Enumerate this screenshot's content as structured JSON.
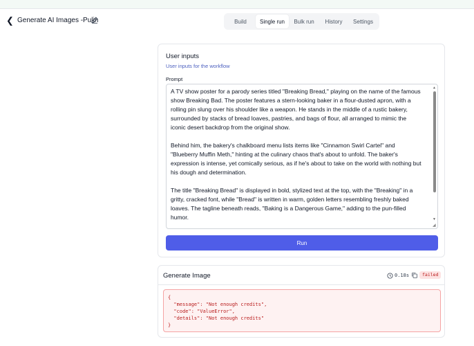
{
  "header": {
    "title": "Generate AI Images -Pulin",
    "back_icon": "chevron-left-icon",
    "edit_icon": "pencil-icon"
  },
  "tabs": [
    {
      "label": "Build",
      "active": false
    },
    {
      "label": "Single run",
      "active": true
    },
    {
      "label": "Bulk run",
      "active": false
    },
    {
      "label": "History",
      "active": false
    },
    {
      "label": "Settings",
      "active": false
    }
  ],
  "inputs_card": {
    "title": "User inputs",
    "subtitle": "User inputs for the workflow",
    "prompt_label": "Prompt",
    "prompt_value": "A TV show poster for a parody series titled \"Breaking Bread,\" playing on the name of the famous\nshow Breaking Bad. The poster features a stern-looking baker in a flour-dusted apron, with a\nrolling pin slung over his shoulder like a weapon. He stands in the middle of a rustic bakery,\nsurrounded by stacks of bread loaves, pastries, and bags of flour, all arranged to mimic the\niconic desert backdrop from the original show.\n\nBehind him, the bakery's chalkboard menu lists items like \"Cinnamon Swirl Cartel\" and\n\"Blueberry Muffin Meth,\" hinting at the culinary chaos that's about to unfold. The baker's\nexpression is intense, yet comically serious, as if he's about to take on the world with nothing but\nhis dough and determination.\n\nThe title \"Breaking Bread\" is displayed in bold, stylized text at the top, with the \"Breaking\" in a\ngritty, cracked font, while \"Bread\" is written in warm, golden letters resembling freshly baked\nloaves. The tagline beneath reads, \"Baking is a Dangerous Game,\" adding to the pun-filled\nhumor.",
    "run_label": "Run"
  },
  "result_card": {
    "title": "Generate Image",
    "duration": "0.18s",
    "status": "failed",
    "error_text": "{\n  \"message\": \"Not enough credits\",\n  \"code\": \"ValueError\",\n  \"details\": \"Not enough credits\"\n}"
  },
  "colors": {
    "accent": "#4f5de8",
    "error_bg": "#fef2f2",
    "error_text": "#b91c1c",
    "subtitle": "#4b5fbf"
  }
}
